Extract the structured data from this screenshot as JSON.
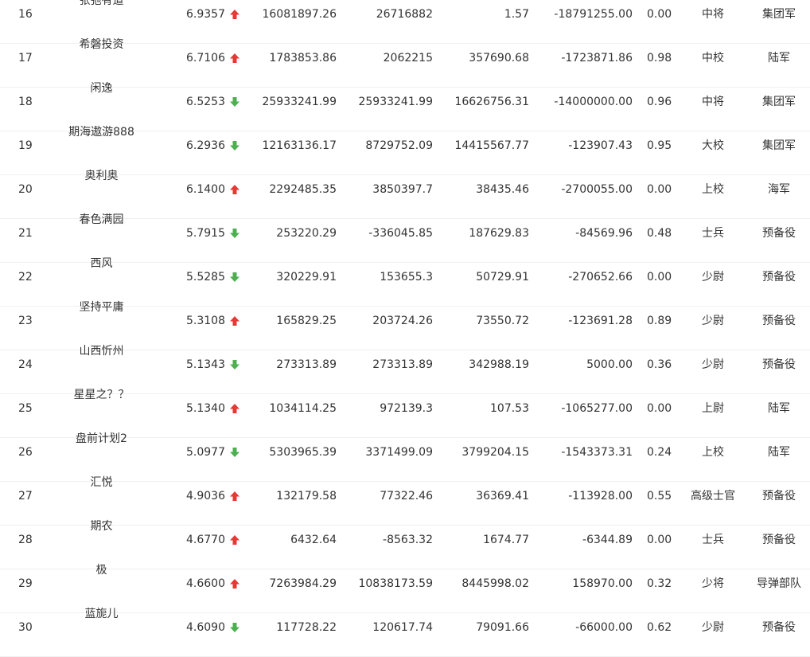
{
  "colors": {
    "up": "#e53935",
    "down": "#4caf50",
    "text": "#333333",
    "divider": "#f0f0f0"
  },
  "rows": [
    {
      "rank": "16",
      "name": "张弛有道",
      "score": "6.9357",
      "trend": "up",
      "trend_icon": "arrow-up-icon",
      "v1": "16081897.26",
      "v2": "26716882",
      "v3": "1.57",
      "v4": "-18791255.00",
      "ratio": "0.00",
      "title": "中将",
      "corps": "集团军"
    },
    {
      "rank": "17",
      "name": "希磐投资",
      "score": "6.7106",
      "trend": "up",
      "trend_icon": "arrow-up-icon",
      "v1": "1783853.86",
      "v2": "2062215",
      "v3": "357690.68",
      "v4": "-1723871.86",
      "ratio": "0.98",
      "title": "中校",
      "corps": "陆军"
    },
    {
      "rank": "18",
      "name": "闲逸",
      "score": "6.5253",
      "trend": "down",
      "trend_icon": "arrow-down-icon",
      "v1": "25933241.99",
      "v2": "25933241.99",
      "v3": "16626756.31",
      "v4": "-14000000.00",
      "ratio": "0.96",
      "title": "中将",
      "corps": "集团军"
    },
    {
      "rank": "19",
      "name": "期海遨游888",
      "score": "6.2936",
      "trend": "down",
      "trend_icon": "arrow-down-icon",
      "v1": "12163136.17",
      "v2": "8729752.09",
      "v3": "14415567.77",
      "v4": "-123907.43",
      "ratio": "0.95",
      "title": "大校",
      "corps": "集团军"
    },
    {
      "rank": "20",
      "name": "奥利奥",
      "score": "6.1400",
      "trend": "up",
      "trend_icon": "arrow-up-icon",
      "v1": "2292485.35",
      "v2": "3850397.7",
      "v3": "38435.46",
      "v4": "-2700055.00",
      "ratio": "0.00",
      "title": "上校",
      "corps": "海军"
    },
    {
      "rank": "21",
      "name": "春色满园",
      "score": "5.7915",
      "trend": "down",
      "trend_icon": "arrow-down-icon",
      "v1": "253220.29",
      "v2": "-336045.85",
      "v3": "187629.83",
      "v4": "-84569.96",
      "ratio": "0.48",
      "title": "士兵",
      "corps": "预备役"
    },
    {
      "rank": "22",
      "name": "西风",
      "score": "5.5285",
      "trend": "down",
      "trend_icon": "arrow-down-icon",
      "v1": "320229.91",
      "v2": "153655.3",
      "v3": "50729.91",
      "v4": "-270652.66",
      "ratio": "0.00",
      "title": "少尉",
      "corps": "预备役"
    },
    {
      "rank": "23",
      "name": "坚持平庸",
      "score": "5.3108",
      "trend": "up",
      "trend_icon": "arrow-up-icon",
      "v1": "165829.25",
      "v2": "203724.26",
      "v3": "73550.72",
      "v4": "-123691.28",
      "ratio": "0.89",
      "title": "少尉",
      "corps": "预备役"
    },
    {
      "rank": "24",
      "name": "山西忻州",
      "score": "5.1343",
      "trend": "down",
      "trend_icon": "arrow-down-icon",
      "v1": "273313.89",
      "v2": "273313.89",
      "v3": "342988.19",
      "v4": "5000.00",
      "ratio": "0.36",
      "title": "少尉",
      "corps": "预备役"
    },
    {
      "rank": "25",
      "name": "星星之？？",
      "score": "5.1340",
      "trend": "up",
      "trend_icon": "arrow-up-icon",
      "v1": "1034114.25",
      "v2": "972139.3",
      "v3": "107.53",
      "v4": "-1065277.00",
      "ratio": "0.00",
      "title": "上尉",
      "corps": "陆军"
    },
    {
      "rank": "26",
      "name": "盘前计划2",
      "score": "5.0977",
      "trend": "down",
      "trend_icon": "arrow-down-icon",
      "v1": "5303965.39",
      "v2": "3371499.09",
      "v3": "3799204.15",
      "v4": "-1543373.31",
      "ratio": "0.24",
      "title": "上校",
      "corps": "陆军"
    },
    {
      "rank": "27",
      "name": "汇悦",
      "score": "4.9036",
      "trend": "up",
      "trend_icon": "arrow-up-icon",
      "v1": "132179.58",
      "v2": "77322.46",
      "v3": "36369.41",
      "v4": "-113928.00",
      "ratio": "0.55",
      "title": "高级士官",
      "corps": "预备役"
    },
    {
      "rank": "28",
      "name": "期农",
      "score": "4.6770",
      "trend": "up",
      "trend_icon": "arrow-up-icon",
      "v1": "6432.64",
      "v2": "-8563.32",
      "v3": "1674.77",
      "v4": "-6344.89",
      "ratio": "0.00",
      "title": "士兵",
      "corps": "预备役"
    },
    {
      "rank": "29",
      "name": "极",
      "score": "4.6600",
      "trend": "up",
      "trend_icon": "arrow-up-icon",
      "v1": "7263984.29",
      "v2": "10838173.59",
      "v3": "8445998.02",
      "v4": "158970.00",
      "ratio": "0.32",
      "title": "少将",
      "corps": "导弹部队"
    },
    {
      "rank": "30",
      "name": "蓝旎儿",
      "score": "4.6090",
      "trend": "down",
      "trend_icon": "arrow-down-icon",
      "v1": "117728.22",
      "v2": "120617.74",
      "v3": "79091.66",
      "v4": "-66000.00",
      "ratio": "0.62",
      "title": "少尉",
      "corps": "预备役"
    }
  ]
}
